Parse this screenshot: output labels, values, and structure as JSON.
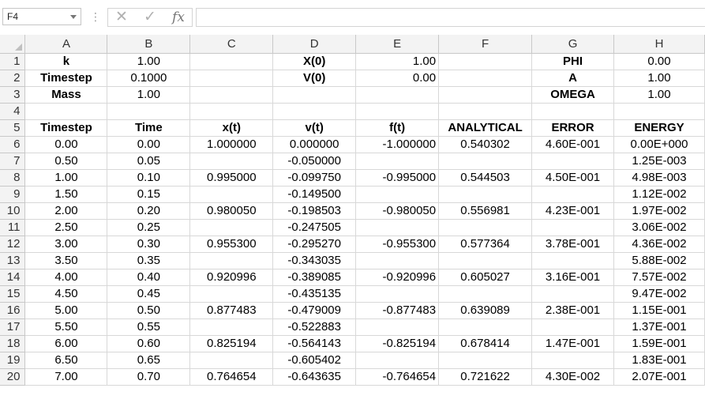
{
  "name_box": {
    "value": "F4"
  },
  "formula_bar": {
    "cancel_icon": "x-icon",
    "enter_icon": "check-icon",
    "fx_label": "fx",
    "value": ""
  },
  "columns": [
    "A",
    "B",
    "C",
    "D",
    "E",
    "F",
    "G",
    "H"
  ],
  "rows": [
    {
      "num": "1",
      "cells": [
        "k",
        "1.00",
        "",
        "X(0)",
        "1.00",
        "",
        "PHI",
        "0.00"
      ]
    },
    {
      "num": "2",
      "cells": [
        "Timestep",
        "0.1000",
        "",
        "V(0)",
        "0.00",
        "",
        "A",
        "1.00"
      ]
    },
    {
      "num": "3",
      "cells": [
        "Mass",
        "1.00",
        "",
        "",
        "",
        "",
        "OMEGA",
        "1.00"
      ]
    },
    {
      "num": "4",
      "cells": [
        "",
        "",
        "",
        "",
        "",
        "",
        "",
        ""
      ]
    },
    {
      "num": "5",
      "cells": [
        "Timestep",
        "Time",
        "x(t)",
        "v(t)",
        "f(t)",
        "ANALYTICAL",
        "ERROR",
        "ENERGY"
      ]
    },
    {
      "num": "6",
      "cells": [
        "0.00",
        "0.00",
        "1.000000",
        "0.000000",
        "-1.000000",
        "0.540302",
        "4.60E-001",
        "0.00E+000"
      ]
    },
    {
      "num": "7",
      "cells": [
        "0.50",
        "0.05",
        "",
        "-0.050000",
        "",
        "",
        "",
        "1.25E-003"
      ]
    },
    {
      "num": "8",
      "cells": [
        "1.00",
        "0.10",
        "0.995000",
        "-0.099750",
        "-0.995000",
        "0.544503",
        "4.50E-001",
        "4.98E-003"
      ]
    },
    {
      "num": "9",
      "cells": [
        "1.50",
        "0.15",
        "",
        "-0.149500",
        "",
        "",
        "",
        "1.12E-002"
      ]
    },
    {
      "num": "10",
      "cells": [
        "2.00",
        "0.20",
        "0.980050",
        "-0.198503",
        "-0.980050",
        "0.556981",
        "4.23E-001",
        "1.97E-002"
      ]
    },
    {
      "num": "11",
      "cells": [
        "2.50",
        "0.25",
        "",
        "-0.247505",
        "",
        "",
        "",
        "3.06E-002"
      ]
    },
    {
      "num": "12",
      "cells": [
        "3.00",
        "0.30",
        "0.955300",
        "-0.295270",
        "-0.955300",
        "0.577364",
        "3.78E-001",
        "4.36E-002"
      ]
    },
    {
      "num": "13",
      "cells": [
        "3.50",
        "0.35",
        "",
        "-0.343035",
        "",
        "",
        "",
        "5.88E-002"
      ]
    },
    {
      "num": "14",
      "cells": [
        "4.00",
        "0.40",
        "0.920996",
        "-0.389085",
        "-0.920996",
        "0.605027",
        "3.16E-001",
        "7.57E-002"
      ]
    },
    {
      "num": "15",
      "cells": [
        "4.50",
        "0.45",
        "",
        "-0.435135",
        "",
        "",
        "",
        "9.47E-002"
      ]
    },
    {
      "num": "16",
      "cells": [
        "5.00",
        "0.50",
        "0.877483",
        "-0.479009",
        "-0.877483",
        "0.639089",
        "2.38E-001",
        "1.15E-001"
      ]
    },
    {
      "num": "17",
      "cells": [
        "5.50",
        "0.55",
        "",
        "-0.522883",
        "",
        "",
        "",
        "1.37E-001"
      ]
    },
    {
      "num": "18",
      "cells": [
        "6.00",
        "0.60",
        "0.825194",
        "-0.564143",
        "-0.825194",
        "0.678414",
        "1.47E-001",
        "1.59E-001"
      ]
    },
    {
      "num": "19",
      "cells": [
        "6.50",
        "0.65",
        "",
        "-0.605402",
        "",
        "",
        "",
        "1.83E-001"
      ]
    },
    {
      "num": "20",
      "cells": [
        "7.00",
        "0.70",
        "0.764654",
        "-0.643635",
        "-0.764654",
        "0.721622",
        "4.30E-002",
        "2.07E-001"
      ]
    }
  ]
}
